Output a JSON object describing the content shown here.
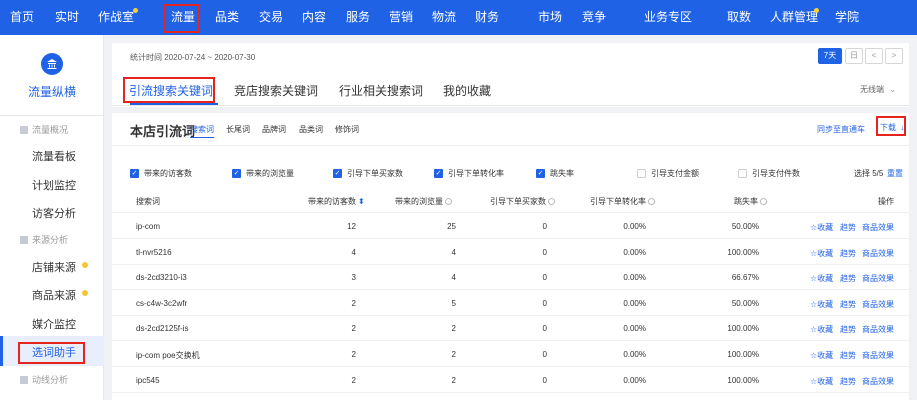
{
  "topnav": {
    "items": [
      "首页",
      "实时",
      "作战室",
      "流量",
      "品类",
      "交易",
      "内容",
      "服务",
      "营销",
      "物流",
      "财务",
      "市场",
      "竞争",
      "业务专区",
      "取数",
      "人群管理",
      "学院"
    ]
  },
  "sidebar": {
    "app_title": "流量纵横",
    "logo_glyph": "🏛",
    "sections": [
      {
        "title": "流量概况",
        "items": [
          "流量看板",
          "计划监控",
          "访客分析"
        ]
      },
      {
        "title": "来源分析",
        "items": [
          "店铺来源",
          "商品来源",
          "媒介监控",
          "选词助手"
        ]
      },
      {
        "title": "动线分析",
        "items": []
      }
    ]
  },
  "header": {
    "date_range": "统计时间 2020-07-24 ~ 2020-07-30",
    "period_btn": "7天",
    "cal_btn": "日",
    "prev_btn": "<",
    "next_btn": ">",
    "tabs": [
      "引流搜索关键词",
      "竞店搜索关键词",
      "行业相关搜索词",
      "我的收藏"
    ],
    "device_select": "无线端"
  },
  "main": {
    "title": "本店引流词",
    "subtabs": [
      "搜索词",
      "长尾词",
      "品牌词",
      "品类词",
      "修饰词"
    ],
    "sync_link": "同步至直通车",
    "download_label": "下载",
    "filters": [
      {
        "label": "带来的访客数",
        "checked": true
      },
      {
        "label": "带来的浏览量",
        "checked": true
      },
      {
        "label": "引导下单买家数",
        "checked": true
      },
      {
        "label": "引导下单转化率",
        "checked": true
      },
      {
        "label": "跳失率",
        "checked": true
      },
      {
        "label": "引导支付金额",
        "checked": false
      },
      {
        "label": "引导支付件数",
        "checked": false
      }
    ],
    "select_count": "选择 5/5",
    "reset": "重置",
    "columns": [
      "搜索词",
      "带来的访客数",
      "带来的浏览量",
      "引导下单买家数",
      "引导下单转化率",
      "跳失率",
      "操作"
    ],
    "rows": [
      {
        "word": "ip-com",
        "visitors": "12",
        "views": "25",
        "buyers": "0",
        "conv": "0.00%",
        "bounce": "50.00%"
      },
      {
        "word": "tl-nvr5216",
        "visitors": "4",
        "views": "4",
        "buyers": "0",
        "conv": "0.00%",
        "bounce": "100.00%"
      },
      {
        "word": "ds-2cd3210-i3",
        "visitors": "3",
        "views": "4",
        "buyers": "0",
        "conv": "0.00%",
        "bounce": "66.67%"
      },
      {
        "word": "cs-c4w-3c2wfr",
        "visitors": "2",
        "views": "5",
        "buyers": "0",
        "conv": "0.00%",
        "bounce": "50.00%"
      },
      {
        "word": "ds-2cd2125f-is",
        "visitors": "2",
        "views": "2",
        "buyers": "0",
        "conv": "0.00%",
        "bounce": "100.00%"
      },
      {
        "word": "ip-com poe交换机",
        "visitors": "2",
        "views": "2",
        "buyers": "0",
        "conv": "0.00%",
        "bounce": "100.00%"
      },
      {
        "word": "ipc545",
        "visitors": "2",
        "views": "2",
        "buyers": "0",
        "conv": "0.00%",
        "bounce": "100.00%"
      }
    ],
    "ops": {
      "fav": "☆收藏",
      "trend": "趋势",
      "effect": "商品效果"
    }
  },
  "colors": {
    "brand": "#2062e6",
    "highlight_box": "#e5231f",
    "dot": "#f7d136"
  }
}
